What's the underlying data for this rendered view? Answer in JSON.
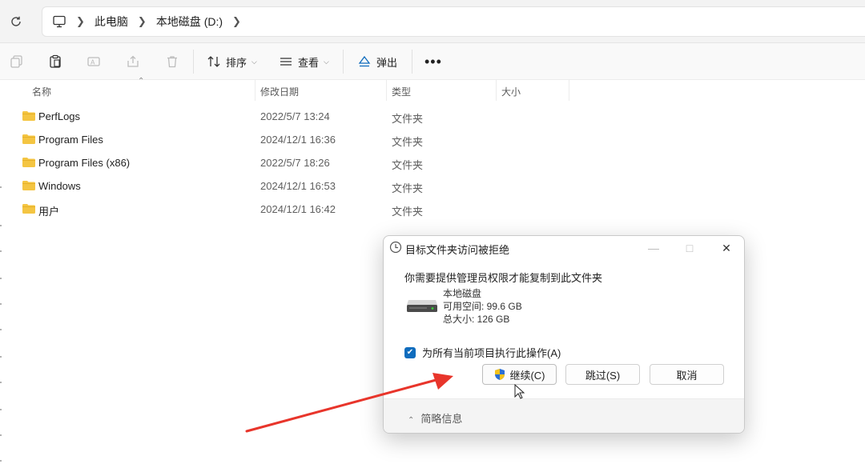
{
  "address": {
    "refresh_icon": "refresh-icon",
    "pc_icon": "computer-icon",
    "crumbs": [
      "此电脑",
      "本地磁盘 (D:)"
    ]
  },
  "toolbar": {
    "sort_label": "排序",
    "view_label": "查看",
    "eject_label": "弹出"
  },
  "columns": {
    "name": "名称",
    "date": "修改日期",
    "type": "类型",
    "size": "大小"
  },
  "rows": [
    {
      "name": "PerfLogs",
      "date": "2022/5/7 13:24",
      "type": "文件夹"
    },
    {
      "name": "Program Files",
      "date": "2024/12/1 16:36",
      "type": "文件夹"
    },
    {
      "name": "Program Files (x86)",
      "date": "2022/5/7 18:26",
      "type": "文件夹"
    },
    {
      "name": "Windows",
      "date": "2024/12/1 16:53",
      "type": "文件夹"
    },
    {
      "name": "用户",
      "date": "2024/12/1 16:42",
      "type": "文件夹"
    }
  ],
  "dialog": {
    "title": "目标文件夹访问被拒绝",
    "message": "你需要提供管理员权限才能复制到此文件夹",
    "drive_name": "本地磁盘",
    "free_space": "可用空间: 99.6 GB",
    "total_size": "总大小: 126 GB",
    "checkbox_label": "为所有当前项目执行此操作(A)",
    "checkbox_checked": true,
    "continue_label": "继续(C)",
    "skip_label": "跳过(S)",
    "cancel_label": "取消",
    "details_label": "简略信息"
  },
  "colors": {
    "accent": "#0f6cbd",
    "folder": "#f4c542",
    "annotation_arrow": "#e8352b"
  }
}
